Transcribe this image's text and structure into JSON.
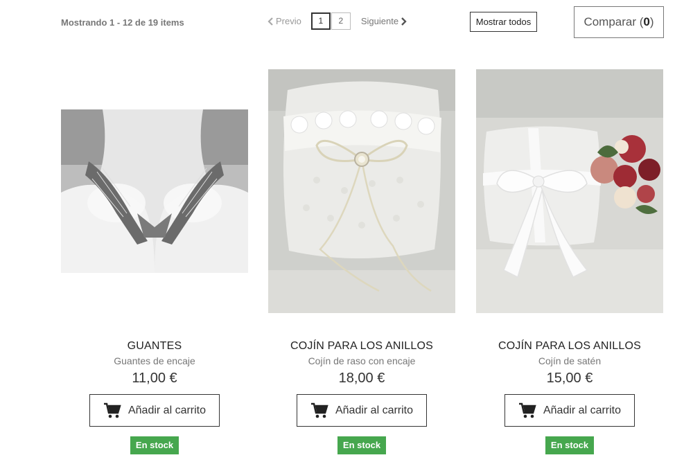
{
  "toolbar": {
    "showing_text": "Mostrando 1 - 12 de 19 items",
    "prev_label": "Previo",
    "pages": [
      "1",
      "2"
    ],
    "next_label": "Siguiente",
    "show_all_label": "Mostrar todos",
    "compare_label": "Comparar (",
    "compare_count": "0",
    "compare_suffix": ")"
  },
  "products": [
    {
      "name": "GUANTES",
      "description": "Guantes de encaje",
      "price": "11,00 €",
      "cart_label": "Añadir al carrito",
      "stock_label": "En stock",
      "image_icon": "lace-gloves-photo"
    },
    {
      "name": "COJÍN PARA LOS ANILLOS",
      "description": "Cojín de raso con encaje",
      "price": "18,00 €",
      "cart_label": "Añadir al carrito",
      "stock_label": "En stock",
      "image_icon": "lace-ring-pillow-photo"
    },
    {
      "name": "COJÍN PARA LOS ANILLOS",
      "description": "Cojín de satén",
      "price": "15,00 €",
      "cart_label": "Añadir al carrito",
      "stock_label": "En stock",
      "image_icon": "satin-ring-pillow-photo"
    }
  ],
  "colors": {
    "stock_green": "#46a74e",
    "border_dark": "#333333"
  }
}
